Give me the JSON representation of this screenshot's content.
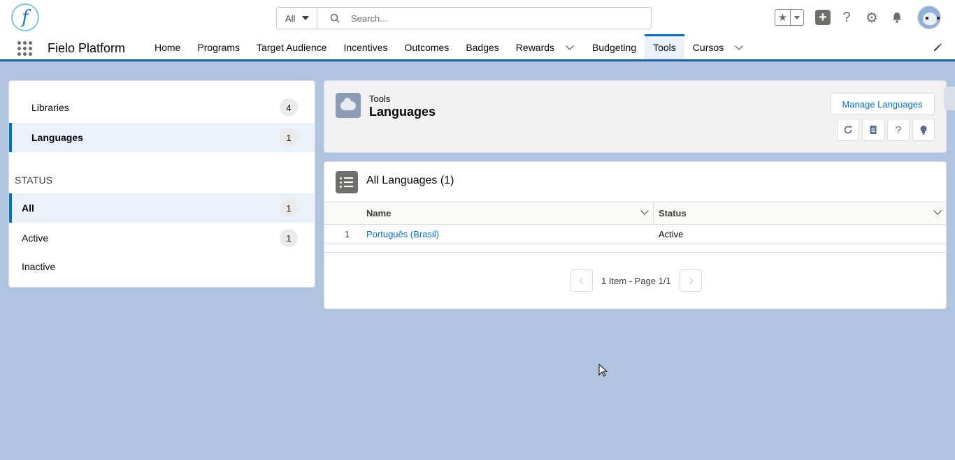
{
  "header": {
    "search_scope": "All",
    "search_placeholder": "Search..."
  },
  "app_nav": {
    "app_name": "Fielo Platform",
    "items": [
      {
        "label": "Home"
      },
      {
        "label": "Programs"
      },
      {
        "label": "Target Audience"
      },
      {
        "label": "Incentives"
      },
      {
        "label": "Outcomes"
      },
      {
        "label": "Badges"
      },
      {
        "label": "Rewards"
      },
      {
        "label": "Budgeting"
      },
      {
        "label": "Tools"
      },
      {
        "label": "Cursos"
      }
    ],
    "active": "Tools"
  },
  "sidebar": {
    "items": [
      {
        "label": "Libraries",
        "count": "4"
      },
      {
        "label": "Languages",
        "count": "1"
      }
    ],
    "status_heading": "STATUS",
    "status_items": [
      {
        "label": "All",
        "count": "1"
      },
      {
        "label": "Active",
        "count": "1"
      },
      {
        "label": "Inactive",
        "count": ""
      }
    ]
  },
  "page_header": {
    "subtitle": "Tools",
    "title": "Languages",
    "manage_button": "Manage Languages"
  },
  "list": {
    "title": "All Languages (1)",
    "columns": [
      "Name",
      "Status"
    ],
    "rows": [
      {
        "num": "1",
        "name": "Português (Brasil)",
        "status": "Active"
      }
    ],
    "pagination": "1 Item - Page 1/1"
  },
  "colors": {
    "brand": "#0070d2",
    "nav_border": "#1b5fa8",
    "background": "#b0c4df"
  }
}
